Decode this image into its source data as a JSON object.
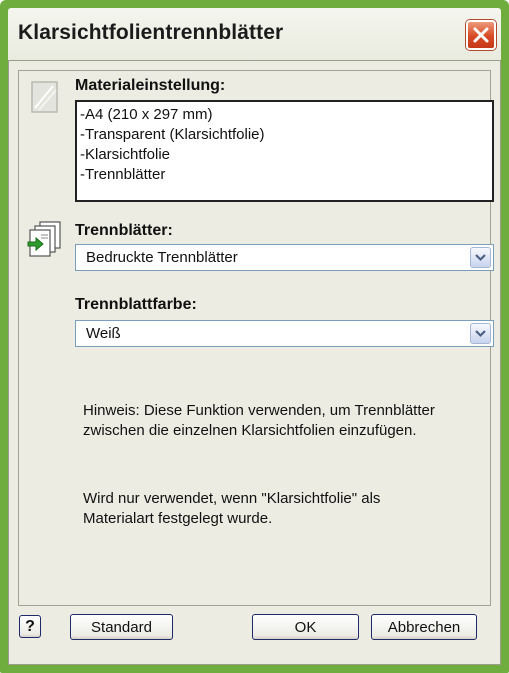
{
  "window": {
    "title": "Klarsichtfolientrennblätter",
    "close_label": "×"
  },
  "material": {
    "label": "Materialeinstellung:",
    "lines": [
      "-A4 (210 x 297 mm)",
      "-Transparent (Klarsichtfolie)",
      "-Klarsichtfolie",
      "-Trennblätter"
    ]
  },
  "separators": {
    "label": "Trennblätter:",
    "value": "Bedruckte Trennblätter"
  },
  "separator_color": {
    "label": "Trennblattfarbe:",
    "value": "Weiß"
  },
  "notes": {
    "hint": "Hinweis: Diese Funktion verwenden, um Trennblätter zwischen die einzelnen Klarsichtfolien einzufügen.",
    "usage": "Wird nur verwendet, wenn \"Klarsichtfolie\" als Materialart festgelegt wurde."
  },
  "buttons": {
    "help": "?",
    "standard": "Standard",
    "ok": "OK",
    "cancel": "Abbrechen"
  },
  "colors": {
    "frame": "#6fae3e",
    "client": "#ecece2",
    "close": "#d84a25"
  },
  "icons": {
    "material": "paper-sheet-icon",
    "separators": "sheet-insert-icon",
    "close": "close-icon",
    "dropdown": "chevron-down-icon"
  }
}
